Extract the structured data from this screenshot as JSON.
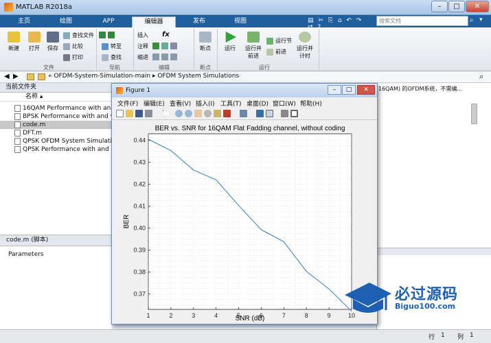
{
  "window": {
    "title": "MATLAB R2018a"
  },
  "tabs": [
    "主页",
    "绘图",
    "APP",
    "编辑器",
    "发布",
    "视图"
  ],
  "search": {
    "placeholder": "搜索文档"
  },
  "ribbon": {
    "file": {
      "new": "新建",
      "open": "打开",
      "save": "保存",
      "find_files": "查找文件",
      "compare": "比较",
      "print": "打印",
      "group": "文件"
    },
    "nav": {
      "goto": "转至",
      "find": "查找",
      "group": "导航"
    },
    "edit": {
      "insert": "插入",
      "comment": "注释",
      "indent": "缩进",
      "fx": "fx",
      "group": "编辑"
    },
    "breakpoints": {
      "label": "断点",
      "group": "断点"
    },
    "run": {
      "run": "运行",
      "run_advance_1": "运行并",
      "run_advance_2": "前进",
      "run_section": "运行节",
      "advance": "前进",
      "run_time_1": "运行并",
      "run_time_2": "计时",
      "group": "运行"
    }
  },
  "path": {
    "sep": "«",
    "parent": "OFDM-System-Simulation-main",
    "child": "OFDM System Simulations"
  },
  "file_browser": {
    "title": "当前文件夹",
    "column": "名称",
    "files": [
      {
        "name": "16QAM Performance with and w"
      },
      {
        "name": "BPSK Performance with and with"
      },
      {
        "name": "code.m"
      },
      {
        "name": "DFT.m"
      },
      {
        "name": "QPSK OFDM System Simulations"
      },
      {
        "name": "QPSK Performance with and with"
      }
    ],
    "details_title": "code.m  (脚本)",
    "details_body": "Parameters"
  },
  "editor_peek": "16QAM) 的OFDM系统，不需编...",
  "figure": {
    "title": "Figure 1",
    "menu": [
      "文件(F)",
      "编辑(E)",
      "查看(V)",
      "插入(I)",
      "工具(T)",
      "桌面(D)",
      "窗口(W)",
      "帮助(H)"
    ]
  },
  "status": {
    "row_label": "行",
    "row_value": "1",
    "col_label": "列",
    "col_value": "1"
  },
  "watermark": {
    "text": "必过源码",
    "url": "Biguo100.com"
  },
  "chart_data": {
    "type": "line",
    "title": "BER vs. SNR for 16QAM Flat Fadding channel, without coding",
    "xlabel": "SNR (dB)",
    "ylabel": "BER",
    "xlim": [
      1,
      10
    ],
    "ylim": [
      0.363,
      0.443
    ],
    "xticks": [
      1,
      2,
      3,
      4,
      5,
      6,
      7,
      8,
      9,
      10
    ],
    "yticks": [
      0.37,
      0.38,
      0.39,
      0.4,
      0.41,
      0.42,
      0.43,
      0.44
    ],
    "grid": true,
    "series": [
      {
        "x": [
          1,
          2,
          3,
          4,
          5,
          6,
          7,
          8,
          9,
          10
        ],
        "y": [
          0.4405,
          0.4353,
          0.4265,
          0.422,
          0.4103,
          0.3993,
          0.3938,
          0.3803,
          0.3723,
          0.3622
        ]
      }
    ],
    "line_color": "#2f7dc2"
  }
}
